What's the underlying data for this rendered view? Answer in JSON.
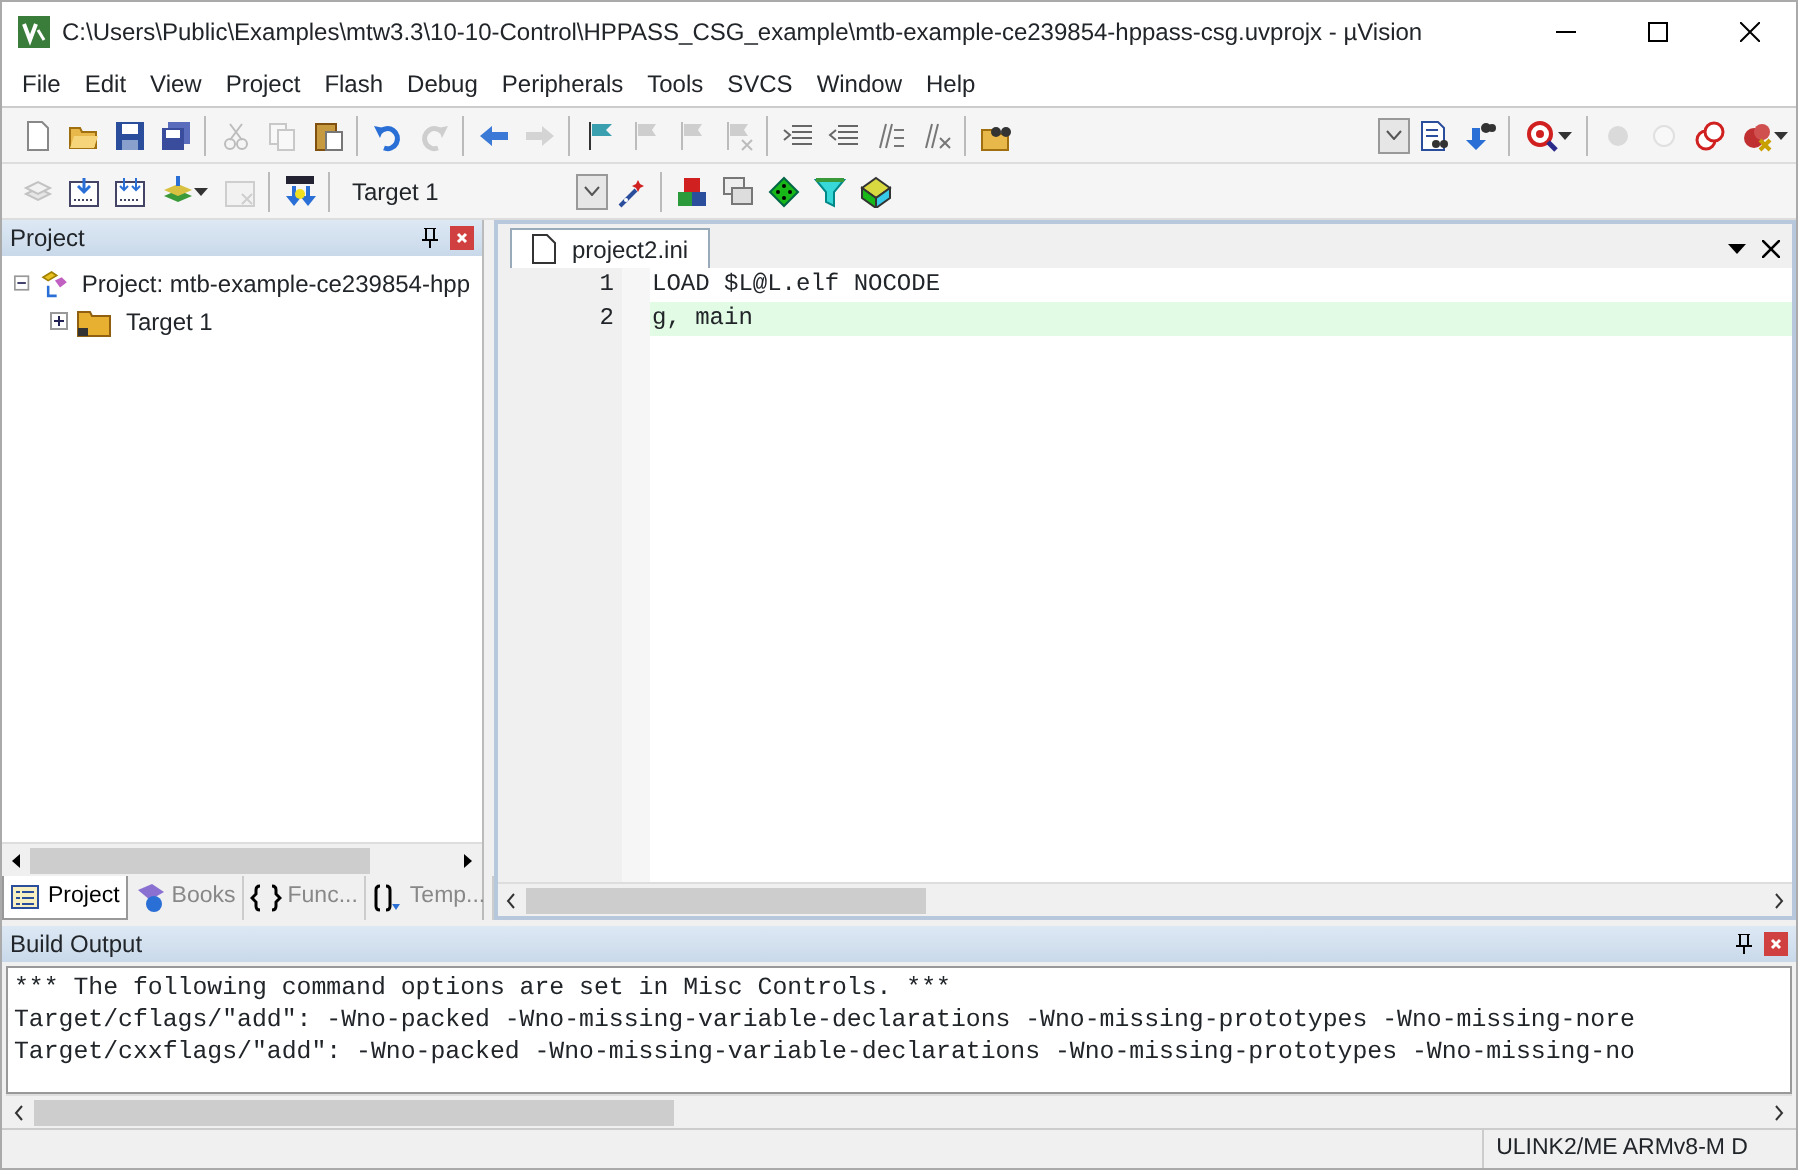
{
  "window": {
    "title": "C:\\Users\\Public\\Examples\\mtw3.3\\10-10-Control\\HPPASS_CSG_example\\mtb-example-ce239854-hppass-csg.uvprojx - µVision"
  },
  "menu": [
    "File",
    "Edit",
    "View",
    "Project",
    "Flash",
    "Debug",
    "Peripherals",
    "Tools",
    "SVCS",
    "Window",
    "Help"
  ],
  "toolbars": [
    {
      "items": [
        {
          "kind": "button",
          "disabled": false
        },
        {
          "kind": "button",
          "disabled": false
        },
        {
          "kind": "button",
          "disabled": false
        },
        {
          "kind": "button",
          "disabled": false
        },
        {
          "kind": "separator"
        },
        {
          "kind": "button",
          "disabled": true
        },
        {
          "kind": "button",
          "disabled": true
        },
        {
          "kind": "button",
          "disabled": false
        },
        {
          "kind": "separator"
        },
        {
          "kind": "button",
          "disabled": false
        },
        {
          "kind": "button",
          "disabled": true
        },
        {
          "kind": "separator"
        },
        {
          "kind": "button",
          "disabled": false
        },
        {
          "kind": "button",
          "disabled": true
        },
        {
          "kind": "separator"
        },
        {
          "kind": "button",
          "disabled": false
        },
        {
          "kind": "button",
          "disabled": true
        },
        {
          "kind": "button",
          "disabled": true
        },
        {
          "kind": "button",
          "disabled": true
        },
        {
          "kind": "separator"
        },
        {
          "kind": "button",
          "disabled": false
        },
        {
          "kind": "button",
          "disabled": false
        },
        {
          "kind": "button",
          "disabled": false
        },
        {
          "kind": "button",
          "disabled": false
        },
        {
          "kind": "separator"
        },
        {
          "kind": "button",
          "disabled": false
        },
        {
          "kind": "spacer"
        },
        {
          "kind": "combo",
          "value": ""
        },
        {
          "kind": "button",
          "disabled": false
        },
        {
          "kind": "button",
          "disabled": false
        },
        {
          "kind": "separator"
        },
        {
          "kind": "button",
          "disabled": false
        },
        {
          "kind": "separator"
        },
        {
          "kind": "button",
          "disabled": true
        },
        {
          "kind": "button",
          "disabled": true
        },
        {
          "kind": "button",
          "disabled": false
        },
        {
          "kind": "button",
          "disabled": false
        }
      ]
    },
    {
      "items": [
        {
          "kind": "button",
          "disabled": true
        },
        {
          "kind": "button",
          "disabled": false
        },
        {
          "kind": "button",
          "disabled": false
        },
        {
          "kind": "button",
          "disabled": false
        },
        {
          "kind": "button",
          "disabled": true
        },
        {
          "kind": "separator"
        },
        {
          "kind": "button",
          "disabled": false
        },
        {
          "kind": "separator"
        },
        {
          "kind": "combo",
          "value": "Target 1"
        },
        {
          "kind": "button",
          "disabled": false
        },
        {
          "kind": "separator"
        },
        {
          "kind": "button",
          "disabled": false
        },
        {
          "kind": "button",
          "disabled": false
        },
        {
          "kind": "button",
          "disabled": false
        },
        {
          "kind": "button",
          "disabled": false
        },
        {
          "kind": "button",
          "disabled": false
        }
      ]
    }
  ],
  "project_panel": {
    "title": "Project",
    "tree": [
      {
        "label": "Project: mtb-example-ce239854-hpp",
        "expanded": true,
        "children": [
          {
            "label": "Target 1",
            "expanded": false
          }
        ]
      }
    ],
    "tabs": [
      {
        "label": "Project",
        "selected": true
      },
      {
        "label": "Books",
        "selected": false
      },
      {
        "label": "Func...",
        "selected": false
      },
      {
        "label": "Temp...",
        "selected": false
      }
    ]
  },
  "editor": {
    "tabs": [
      {
        "label": "project2.ini",
        "selected": true
      }
    ],
    "lines": [
      {
        "number": "1",
        "text": "LOAD $L@L.elf NOCODE",
        "current": false
      },
      {
        "number": "2",
        "text": "g, main",
        "current": true
      }
    ]
  },
  "build_output": {
    "title": "Build Output",
    "lines": [
      "*** The following command options are set in Misc Controls. ***",
      "Target/cflags/\"add\": -Wno-packed -Wno-missing-variable-declarations -Wno-missing-prototypes -Wno-missing-nore",
      "Target/cxxflags/\"add\": -Wno-packed -Wno-missing-variable-declarations -Wno-missing-prototypes -Wno-missing-no"
    ]
  },
  "status_bar": {
    "text": "ULINK2/ME ARMv8-M D"
  }
}
